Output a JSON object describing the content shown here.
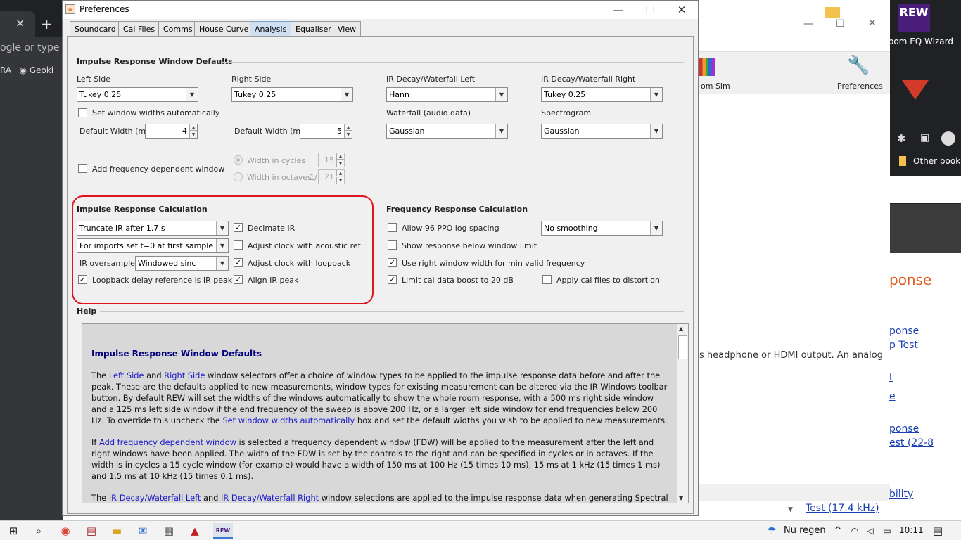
{
  "background": {
    "chrome": {
      "tab_close": "×",
      "new_tab": "+",
      "omnibox_text": "ogle or type",
      "bookmark_1": "RA",
      "bookmark_2": "Geoki",
      "other_bookmarks": "Other bookm"
    },
    "rew": {
      "room_sim_label": "om Sim",
      "preferences_label": "Preferences",
      "heading_fragment": "ponse",
      "body_fragment": "s headphone or HDMI output. An analog",
      "links": [
        "ponse",
        "p Test",
        "t",
        "e",
        "ponse",
        "est (22-8",
        "bility",
        "Test (17.4 kHz)"
      ]
    },
    "desktop": {
      "rew_icon": "REW",
      "rew_wizard_label": "oom EQ Wizard"
    }
  },
  "taskbar": {
    "weather": "Nu regen",
    "time": "10:11"
  },
  "dialog": {
    "title": "Preferences",
    "tabs": [
      "Soundcard",
      "Cal Files",
      "Comms",
      "House Curve",
      "Analysis",
      "Equaliser",
      "View"
    ],
    "active_tab": "Analysis",
    "ir_window": {
      "title": "Impulse Response Window Defaults",
      "left_side_label": "Left Side",
      "left_side_value": "Tukey 0.25",
      "right_side_label": "Right Side",
      "right_side_value": "Tukey 0.25",
      "ir_decay_left_label": "IR Decay/Waterfall Left",
      "ir_decay_left_value": "Hann",
      "ir_decay_right_label": "IR Decay/Waterfall Right",
      "ir_decay_right_value": "Tukey 0.25",
      "set_auto_label": "Set window widths automatically",
      "default_width_label": "Default Width (ms)",
      "left_width": "4",
      "right_width": "5",
      "waterfall_label": "Waterfall (audio data)",
      "waterfall_value": "Gaussian",
      "spectrogram_label": "Spectrogram",
      "spectrogram_value": "Gaussian",
      "fdw_label": "Add frequency dependent window",
      "cycles_label": "Width in cycles",
      "cycles_value": "15",
      "octaves_label": "Width in octaves",
      "octaves_prefix": "1/",
      "octaves_value": "21"
    },
    "ir_calc": {
      "title": "Impulse Response Calculation",
      "truncate_value": "Truncate IR after 1.7 s",
      "imports_value": "For imports set t=0 at first sample",
      "oversampler_label": "IR oversampler:",
      "oversampler_value": "Windowed sinc",
      "loopback_delay_label": "Loopback delay reference is IR peak",
      "decimate_label": "Decimate IR",
      "adjust_acoustic_label": "Adjust clock with acoustic ref",
      "adjust_loopback_label": "Adjust clock with loopback",
      "align_peak_label": "Align IR peak"
    },
    "fr_calc": {
      "title": "Frequency Response Calculation",
      "ppo_label": "Allow 96 PPO log spacing",
      "smoothing_value": "No  smoothing",
      "below_limit_label": "Show response below window limit",
      "right_window_label": "Use right window width for min valid frequency",
      "limit_cal_label": "Limit cal data boost to 20 dB",
      "apply_cal_label": "Apply cal files to distortion"
    },
    "help": {
      "title": "Help",
      "heading": "Impulse Response Window Defaults",
      "p1": {
        "a": "The ",
        "k1": "Left Side",
        "b": " and ",
        "k2": "Right Side",
        "c": " window selectors offer a choice of window types to be applied to the impulse response data before and after the peak. These are the defaults applied to new measurements, window types for existing measurement can be altered via the IR Windows toolbar button. By default REW will set the widths of the windows automatically to show the whole room response, with a 500 ms right side window and a 125 ms left side window if the end frequency of the sweep is above 200 Hz, or a larger left side window for end frequencies below 200 Hz. To override this uncheck the ",
        "k3": "Set window widths automatically",
        "d": " box and set the default widths you wish to be applied to new measurements."
      },
      "p2": {
        "a": "If ",
        "k1": "Add frequency dependent window",
        "b": " is selected a frequency dependent window (FDW) will be applied to the measurement after the left and right windows have been applied. The width of the FDW is set by the controls to the right and can be specified in cycles or in octaves. If the width is in cycles a 15 cycle window (for example) would have a width of 150 ms at 100 Hz (15 times 10 ms), 15 ms at 1 kHz (15 times 1 ms) and 1.5 ms at 10 kHz (15 times 0.1 ms)."
      },
      "p3": {
        "a": "The ",
        "k1": "IR Decay/Waterfall Left",
        "b": " and ",
        "k2": "IR Decay/Waterfall Right",
        "c": " window selections are applied to the impulse response data when generating Spectral"
      }
    }
  }
}
